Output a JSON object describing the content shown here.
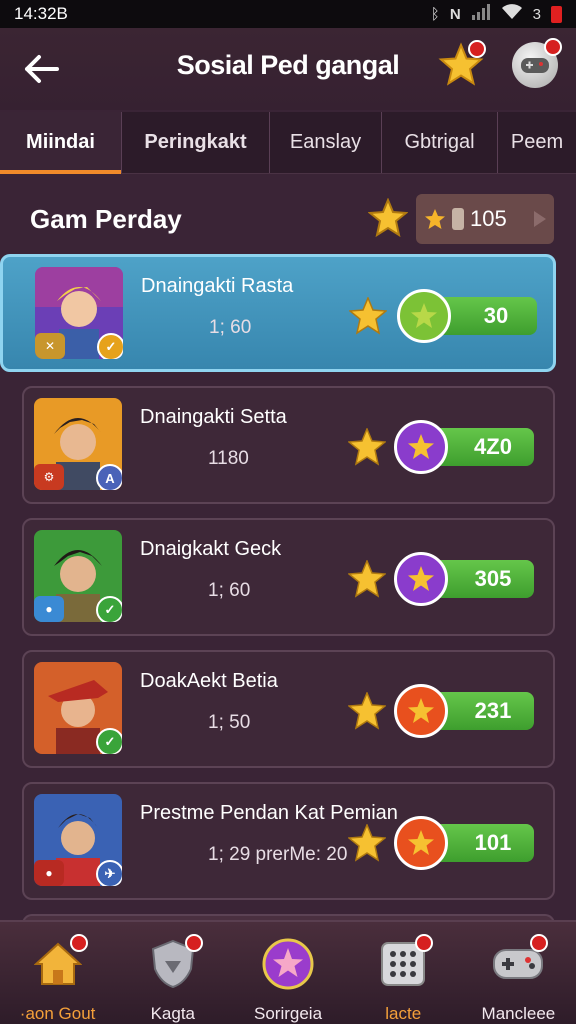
{
  "status_bar": {
    "time": "14:32B",
    "battery_text": "3"
  },
  "header": {
    "title": "Sosial Ped gangal"
  },
  "tabs": [
    {
      "label": "Miindai"
    },
    {
      "label": "Peringkakt"
    },
    {
      "label": "Eanslay"
    },
    {
      "label": "Gbtrigal"
    },
    {
      "label": "Peem"
    }
  ],
  "section": {
    "title": "Gam Perday",
    "counter_value": "105"
  },
  "players": [
    {
      "name": "Dnaingakti Rasta",
      "stat": "1; 60",
      "score": "30",
      "ball_color": "#7cc236",
      "highlight": true
    },
    {
      "name": "Dnaingakti Setta",
      "stat": "1180",
      "score": "4Z0",
      "ball_color": "#8a3ccc",
      "highlight": false
    },
    {
      "name": "Dnaigkakt Geck",
      "stat": "1; 60",
      "score": "305",
      "ball_color": "#8a3ccc",
      "highlight": false
    },
    {
      "name": "DoakAekt Betia",
      "stat": "1; 50",
      "score": "231",
      "ball_color": "#e8501e",
      "highlight": false
    },
    {
      "name": "Prestme Pendan Kat Pemian",
      "stat": "1; 29 prerMe: 20",
      "score": "101",
      "ball_color": "#e8501e",
      "highlight": false
    }
  ],
  "nav": [
    {
      "label": "·aon Gout",
      "icon": "home-icon"
    },
    {
      "label": "Kagta",
      "icon": "shield-icon"
    },
    {
      "label": "Sorirgeia",
      "icon": "star-orb-icon"
    },
    {
      "label": "lacte",
      "icon": "dice-icon"
    },
    {
      "label": "Mancleee",
      "icon": "gamepad-icon"
    }
  ],
  "colors": {
    "accent": "#f08a2a",
    "highlight": "#4ea2c8",
    "score_green": "#4eae3a"
  }
}
